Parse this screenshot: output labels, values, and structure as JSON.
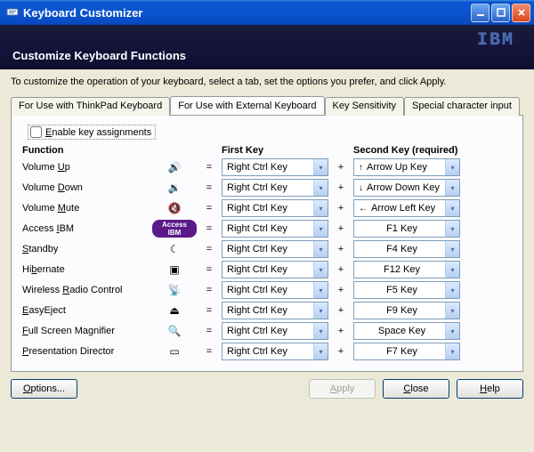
{
  "window": {
    "title": "Keyboard Customizer"
  },
  "header": {
    "title": "Customize Keyboard Functions",
    "logo": "IBM"
  },
  "instruction": "To customize the operation of your keyboard,  select a tab, set the options you prefer, and click Apply.",
  "tabs": [
    {
      "label": "For Use with ThinkPad Keyboard",
      "active": false
    },
    {
      "label": "For Use with External Keyboard",
      "active": true
    },
    {
      "label": "Key Sensitivity",
      "active": false
    },
    {
      "label": "Special character input",
      "active": false
    }
  ],
  "enable_checkbox": {
    "label": "Enable key assignments",
    "checked": false
  },
  "columns": {
    "function": "Function",
    "first_key": "First Key",
    "second_key": "Second Key (required)"
  },
  "symbols": {
    "eq": "=",
    "plus": "+"
  },
  "rows": [
    {
      "label": "Volume Up",
      "icon": "🔊",
      "first": "Right Ctrl Key",
      "second": "Arrow Up Key",
      "second_pre": "↑"
    },
    {
      "label": "Volume Down",
      "icon": "🔉",
      "first": "Right Ctrl Key",
      "second": "Arrow Down Key",
      "second_pre": "↓"
    },
    {
      "label": "Volume Mute",
      "icon": "🔇",
      "first": "Right Ctrl Key",
      "second": "Arrow Left Key",
      "second_pre": "←"
    },
    {
      "label": "Access IBM",
      "icon": "pill",
      "first": "Right Ctrl Key",
      "second": "F1 Key",
      "second_pre": ""
    },
    {
      "label": "Standby",
      "icon": "☾",
      "first": "Right Ctrl Key",
      "second": "F4 Key",
      "second_pre": ""
    },
    {
      "label": "Hibernate",
      "icon": "▣",
      "first": "Right Ctrl Key",
      "second": "F12 Key",
      "second_pre": ""
    },
    {
      "label": "Wireless Radio Control",
      "icon": "📡",
      "first": "Right Ctrl Key",
      "second": "F5 Key",
      "second_pre": ""
    },
    {
      "label": "EasyEject",
      "icon": "⏏",
      "first": "Right Ctrl Key",
      "second": "F9 Key",
      "second_pre": ""
    },
    {
      "label": "Full Screen Magnifier",
      "icon": "🔍",
      "first": "Right Ctrl Key",
      "second": "Space Key",
      "second_pre": ""
    },
    {
      "label": "Presentation Director",
      "icon": "▭",
      "first": "Right Ctrl Key",
      "second": "F7 Key",
      "second_pre": ""
    }
  ],
  "row_underline_hints": [
    "U",
    "D",
    "M",
    "I",
    "S",
    "b",
    "R",
    "E",
    "F",
    "P"
  ],
  "buttons": {
    "options": "Options...",
    "apply": "Apply",
    "close": "Close",
    "help": "Help"
  }
}
